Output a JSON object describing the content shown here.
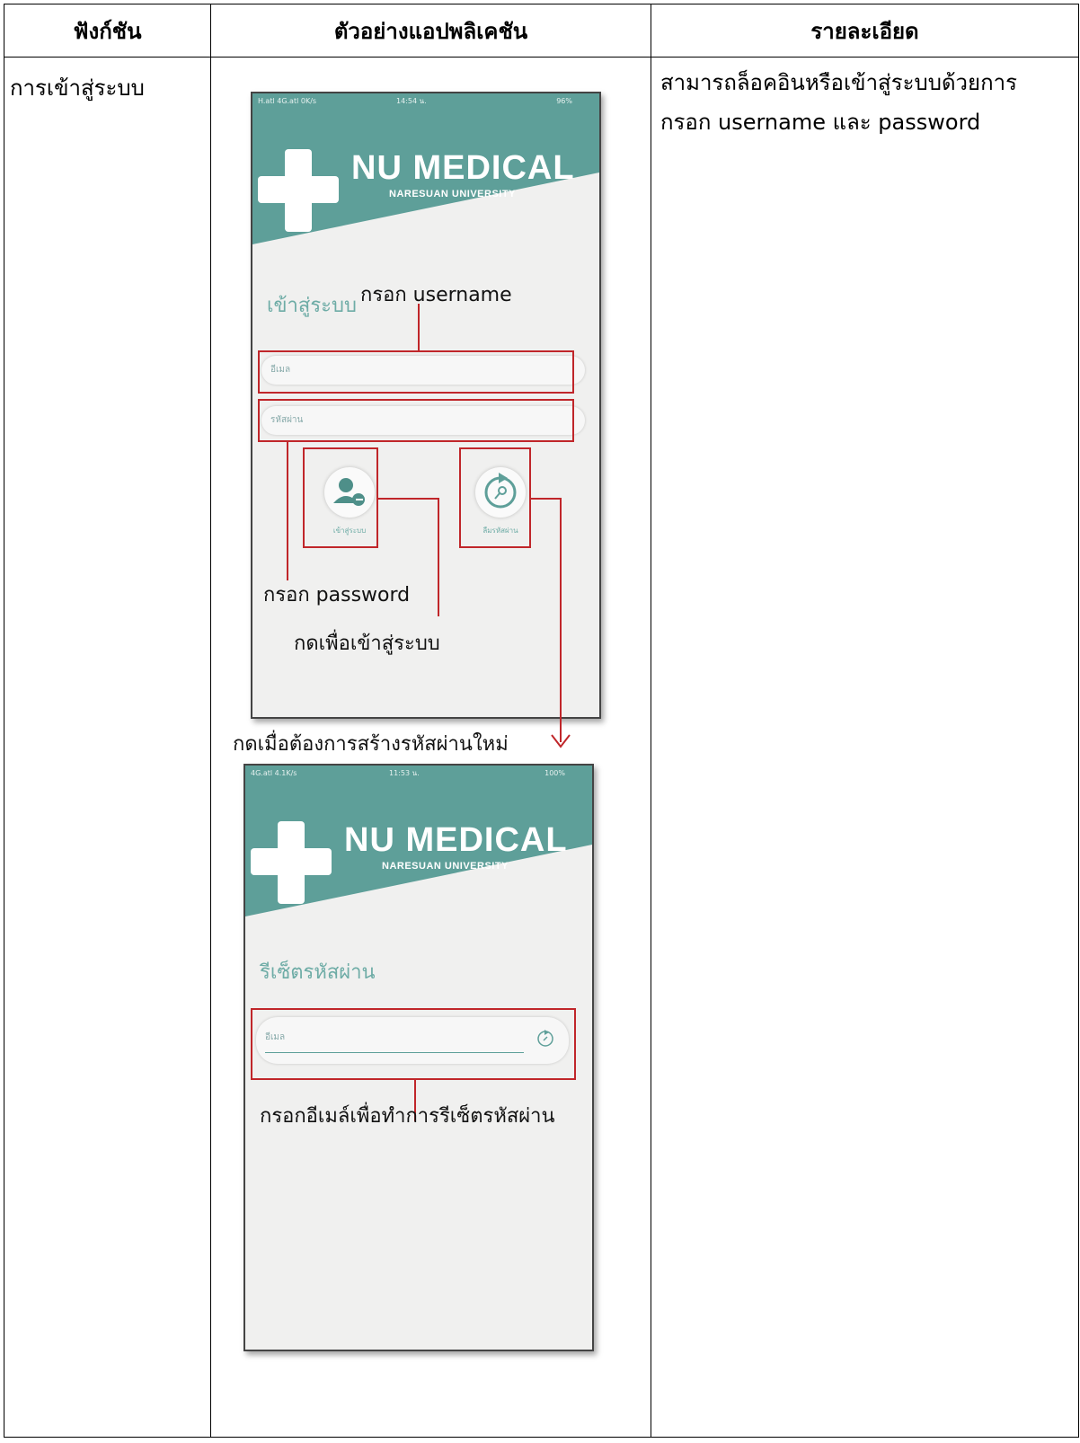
{
  "table": {
    "headers": [
      "ฟังก์ชัน",
      "ตัวอย่างแอปพลิเคชัน",
      "รายละเอียด"
    ],
    "row": {
      "function": "การเข้าสู่ระบบ",
      "description_lines": [
        "สามารถล็อคอินหรือเข้าสู่ระบบด้วยการ",
        "กรอก username และ password"
      ]
    }
  },
  "login_screen": {
    "status_left": "H.atl 4G.atl 0K/s",
    "status_time": "14:54 น.",
    "status_right": "96%",
    "brand": "NU MEDICAL",
    "brand_sub": "NARESUAN UNIVERSITY",
    "title": "เข้าสู่ระบบ",
    "email_placeholder": "อีเมล",
    "password_placeholder": "รหัสผ่าน",
    "login_button_label": "เข้าสู่ระบบ",
    "reset_button_label": "ลืมรหัสผ่าน",
    "login_icon": "user-key-icon",
    "reset_icon": "refresh-key-icon"
  },
  "reset_screen": {
    "status_left": "4G.atl 4.1K/s",
    "status_time": "11:53 น.",
    "status_right": "100%",
    "brand": "NU MEDICAL",
    "brand_sub": "NARESUAN UNIVERSITY",
    "title": "รีเซ็ตรหัสผ่าน",
    "email_placeholder": "อีเมล",
    "submit_icon": "refresh-key-icon"
  },
  "annotations": {
    "username": "กรอก username",
    "password": "กรอก password",
    "login": "กดเพื่อเข้าสู่ระบบ",
    "new_password": "กดเมื่อต้องการสร้างรหัสผ่านใหม่",
    "reset_email": "กรอกอีเมล์เพื่อทำการรีเซ็ตรหัสผ่าน"
  },
  "colors": {
    "teal": "#5e9f99",
    "annotation_red": "#c0262a",
    "screen_bg": "#f0f0ef"
  }
}
